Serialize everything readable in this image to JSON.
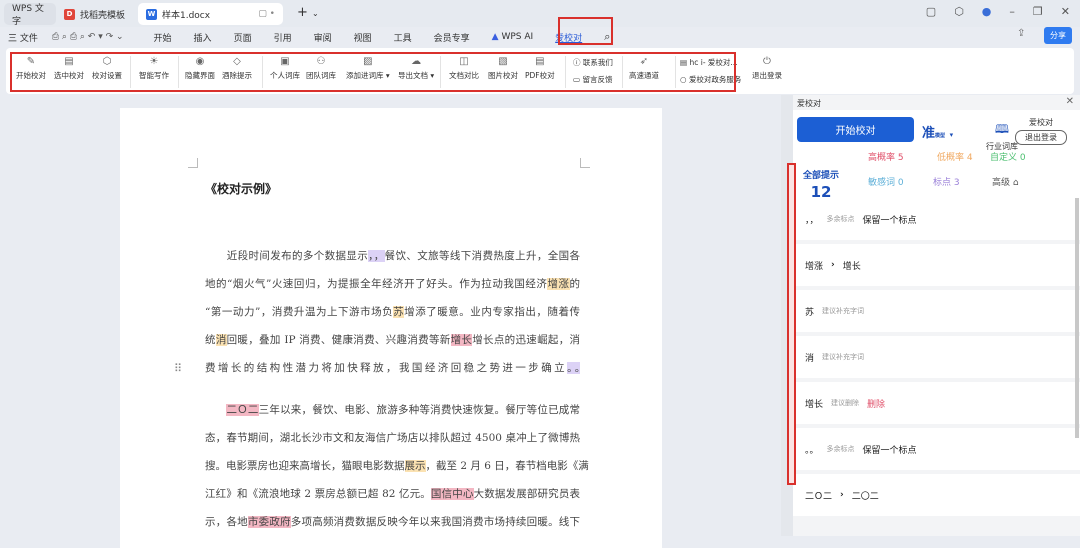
{
  "tabs": [
    {
      "label": "WPS 文字"
    },
    {
      "label": "找稻壳模板"
    },
    {
      "label": "样本1.docx"
    }
  ],
  "menu": {
    "file": "三 文件",
    "items": [
      "开始",
      "插入",
      "页面",
      "引用",
      "审阅",
      "视图",
      "工具",
      "会员专享"
    ],
    "ai": "WPS AI",
    "active": "爱校对",
    "share": "分享"
  },
  "ribbon": {
    "buttons": [
      "开始校对",
      "选中校对",
      "校对设置",
      "智能写作",
      "隐藏界面",
      "酒除提示",
      "个人词库",
      "团队词库",
      "添加进词库 ▾",
      "导出文档 ▾",
      "文档对比",
      "图片校对",
      "PDF校对"
    ],
    "contact": "联系我们",
    "feedback": "留言反馈",
    "fast": "高速通道",
    "account": "hc i- 爱校对...",
    "gov": "爱校对政务服务",
    "logout": "退出登录"
  },
  "doc": {
    "title": "《校对示例》",
    "lines": [
      [
        {
          "t": "　　近段时间发布的多个数据显示"
        },
        {
          "t": "，，",
          "h": "purple"
        },
        {
          "t": "餐饮、文旅等线下消费热度上升，全国各"
        }
      ],
      [
        {
          "t": "地的“烟火气”火速回归，为提振全年经济开了好头。作为拉动我国经济"
        },
        {
          "t": "增涨",
          "h": "orange"
        },
        {
          "t": "的"
        }
      ],
      [
        {
          "t": "“第一动力”，消费升温为上下游市场负"
        },
        {
          "t": "苏",
          "h": "orange"
        },
        {
          "t": "增添了暖意。业内专家指出，随着传"
        }
      ],
      [
        {
          "t": "统"
        },
        {
          "t": "消",
          "h": "orange"
        },
        {
          "t": "回暖，叠加 IP 消费、健康消费、兴趣消费等新"
        },
        {
          "t": "增长",
          "h": "pink"
        },
        {
          "t": "增长点的迅速崛起，消"
        }
      ],
      [
        {
          "t": "费增长的结构性潜力将加快释放，我国经济回稳之势进一步确立"
        },
        {
          "t": "。。",
          "h": "purple"
        },
        {
          "t": "　　　　　　"
        }
      ],
      [
        {
          "t": "　　"
        },
        {
          "t": "二Ｏ二",
          "h": "pink"
        },
        {
          "t": "三年以来，餐饮、电影、旅游多种等消费快速恢复。餐厅等位已成常"
        }
      ],
      [
        {
          "t": "态，春节期间，湖北长沙市文和友海信广场店以排队超过 4500 桌冲上了微博热"
        }
      ],
      [
        {
          "t": "搜。电影票房也迎来高增长，猫眼电影数据"
        },
        {
          "t": "展示",
          "h": "orange"
        },
        {
          "t": "，截至 2 月 6 日，春节档电影《满"
        }
      ],
      [
        {
          "t": "江红》和《流浪地球 2 票房总额已超 82 亿元。"
        },
        {
          "t": "国信中心",
          "h": "pink"
        },
        {
          "t": "大数据发展部研究员表"
        }
      ],
      [
        {
          "t": "示，各地"
        },
        {
          "t": "市委政府",
          "h": "pink"
        },
        {
          "t": "多项高频消费数据反映今年以来我国消费市场持续回暖。线下"
        }
      ]
    ]
  },
  "panel": {
    "title": "爱校对",
    "start": "开始校对",
    "mode": "准",
    "mode_sub": "模型",
    "lib": "行业词库",
    "brand": "爱校对",
    "logout": "退出登录",
    "all_label": "全部提示",
    "all_count": "12",
    "cats": [
      {
        "label": "高概率 5",
        "color": "#e0506a"
      },
      {
        "label": "低概率 4",
        "color": "#f0a860"
      },
      {
        "label": "自定义 0",
        "color": "#4cbf70"
      },
      {
        "label": "敏感词 0",
        "color": "#5fb0d8"
      },
      {
        "label": "标点 3",
        "color": "#9a80d8"
      },
      {
        "label": "高级 ⌂",
        "color": "#555"
      }
    ],
    "items": [
      {
        "orig": "，，",
        "type": "多余标点",
        "fix": "保留一个标点"
      },
      {
        "orig": "增涨",
        "arrow": "›",
        "fix": "增长"
      },
      {
        "orig": "苏",
        "type": "建议补充字词"
      },
      {
        "orig": "消",
        "type": "建议补充字词"
      },
      {
        "orig": "增长",
        "type": "建议删除",
        "del": "删除"
      },
      {
        "orig": "。。",
        "type": "多余标点",
        "fix": "保留一个标点"
      },
      {
        "orig": "二Ｏ二",
        "arrow": "›",
        "fix": "二〇二"
      }
    ]
  }
}
